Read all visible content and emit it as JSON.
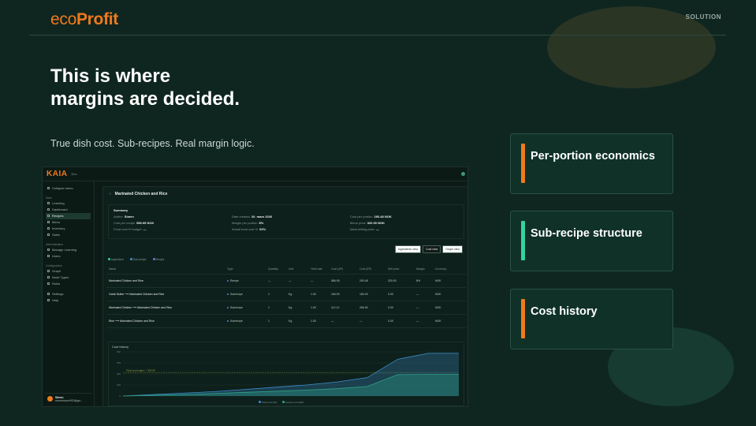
{
  "brand": {
    "prefix": "eco",
    "suffix": "Profit",
    "accent": "#f07a1c"
  },
  "section_tag": "SOLUTION",
  "headline": {
    "line1": "This is where",
    "line2": "margins are decided."
  },
  "subline": "True dish cost. Sub-recipes. Real margin logic.",
  "features": [
    {
      "label": "Per-portion economics",
      "accent": "#f07a1c"
    },
    {
      "label": "Sub-recipe structure",
      "accent": "#35d3a0"
    },
    {
      "label": "Cost history",
      "accent": "#f07a1c"
    }
  ],
  "app": {
    "logo": "KAIA",
    "workspace": "Dev",
    "sidebar": {
      "collapse": "Collapse menu",
      "groups": [
        {
          "title": "Main",
          "items": [
            "Learning",
            "Dashboard",
            "Recipes",
            "Menu",
            "Inventory",
            "Sales"
          ]
        },
        {
          "title": "Administration",
          "items": [
            "Manage Learning",
            "Users"
          ]
        },
        {
          "title": "Configuration",
          "items": [
            "Graph",
            "Node Types",
            "Rules"
          ]
        },
        {
          "title": "",
          "items": [
            "Settings",
            "Help"
          ]
        }
      ],
      "user": {
        "name": "Simen",
        "email": "simenbeyer992@gm..."
      }
    },
    "recipe_title": "Marinated Chicken and Rice",
    "summary": {
      "title": "Summary",
      "fields": [
        {
          "label": "Author",
          "value": "Simen"
        },
        {
          "label": "Date created",
          "value": "20. mars 2026"
        },
        {
          "label": "Cost per portion",
          "value": "293.48 NOK"
        },
        {
          "label": "Cost per recipe",
          "value": "586.95 NOK"
        },
        {
          "label": "Margin per portion",
          "value": "8%"
        },
        {
          "label": "Menu price",
          "value": "320.00 NOK"
        },
        {
          "label": "Food cost % budget",
          "value": "—"
        },
        {
          "label": "Actual food cost %",
          "value": "92%"
        },
        {
          "label": "Ideal selling price",
          "value": "—"
        }
      ]
    },
    "view_buttons": [
      "Ingredients view",
      "Cost view",
      "Graph view"
    ],
    "legend": [
      "Ingredient",
      "Sub-recipe",
      "Recipe"
    ],
    "table": {
      "headers": [
        "Name",
        "Type",
        "Quantity",
        "Unit",
        "Yield rate",
        "Cost (AP)",
        "Cost (EP)",
        "Sell price",
        "Margin",
        "Currency"
      ],
      "rows": [
        [
          "Marinated Chicken and Rice",
          "Recipe",
          "—",
          "—",
          "—",
          "586.95",
          "293.48",
          "320.00",
          "8%",
          "NOK"
        ],
        [
          "Garlic Butter ⟶ Marinated Chicken and Rice",
          "Subrecipe",
          "1",
          "Kg",
          "1.00",
          "160.00",
          "160.00",
          "0.00",
          "—",
          "NOK"
        ],
        [
          "Marinated Chicken ⟶ Marinated Chicken and Rice",
          "Subrecipe",
          "1",
          "Kg",
          "1.00",
          "112.12",
          "266.90",
          "0.00",
          "—",
          "NOK"
        ],
        [
          "Rice ⟶ Marinated Chicken and Rice",
          "Subrecipe",
          "1",
          "Kg",
          "1.00",
          "—",
          "—",
          "0.00",
          "—",
          "NOK"
        ]
      ]
    },
    "chart_data": {
      "type": "area",
      "title": "Cost history",
      "series": [
        {
          "name": "Total cost (AP)",
          "color": "#3d8fd1",
          "values": [
            0,
            20,
            40,
            60,
            90,
            120,
            150,
            190,
            250,
            500,
            580,
            580
          ]
        },
        {
          "name": "Cost per unit (EP)",
          "color": "#2ea38a",
          "values": [
            0,
            10,
            20,
            35,
            50,
            65,
            80,
            100,
            130,
            290,
            293,
            293
          ]
        }
      ],
      "reference_label": "Total cost budget — 320.00",
      "reference_value": 320,
      "ylim": [
        0,
        600
      ],
      "yticks": [
        "0",
        "150",
        "300",
        "450",
        "600"
      ]
    }
  }
}
